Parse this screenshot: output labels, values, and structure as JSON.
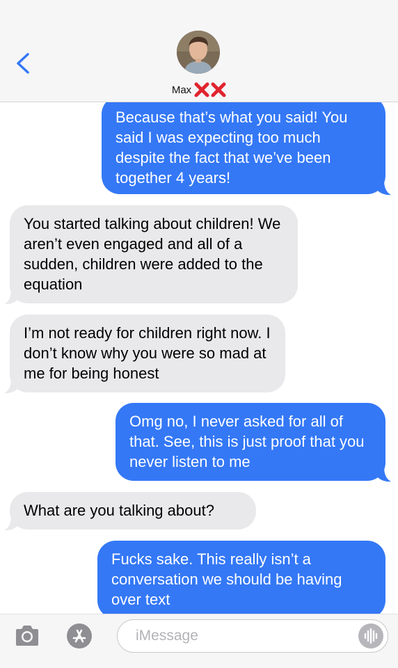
{
  "header": {
    "contact_name": "Max",
    "contact_emoji": "❌❌",
    "avatar_icon": "contact-avatar-photo",
    "back_icon": "chevron-left-icon",
    "accent_color": "#3478f6"
  },
  "messages": [
    {
      "direction": "sent",
      "text": "Because that’s what you said! You said I was expecting too much despite the fact that we’ve been together 4 years!"
    },
    {
      "direction": "received",
      "text": "You started talking about children! We aren’t even engaged and all of a sudden, children were added to the equation"
    },
    {
      "direction": "received",
      "text": "I’m not ready for children right now. I don’t know why you were so mad at me for being honest"
    },
    {
      "direction": "sent",
      "text": "Omg no, I never asked for all of that. See, this is just proof that you never listen to me"
    },
    {
      "direction": "received",
      "text": "What are you talking about?"
    },
    {
      "direction": "sent",
      "text": "Fucks sake. This really isn’t a conversation we should be having over text"
    }
  ],
  "composer": {
    "placeholder": "iMessage",
    "camera_icon": "camera-icon",
    "apps_icon": "app-store-icon",
    "audio_icon": "audio-waveform-icon"
  },
  "colors": {
    "sent_bubble": "#3478f6",
    "received_bubble": "#e9e9eb",
    "emoji_red": "#e0242f"
  }
}
